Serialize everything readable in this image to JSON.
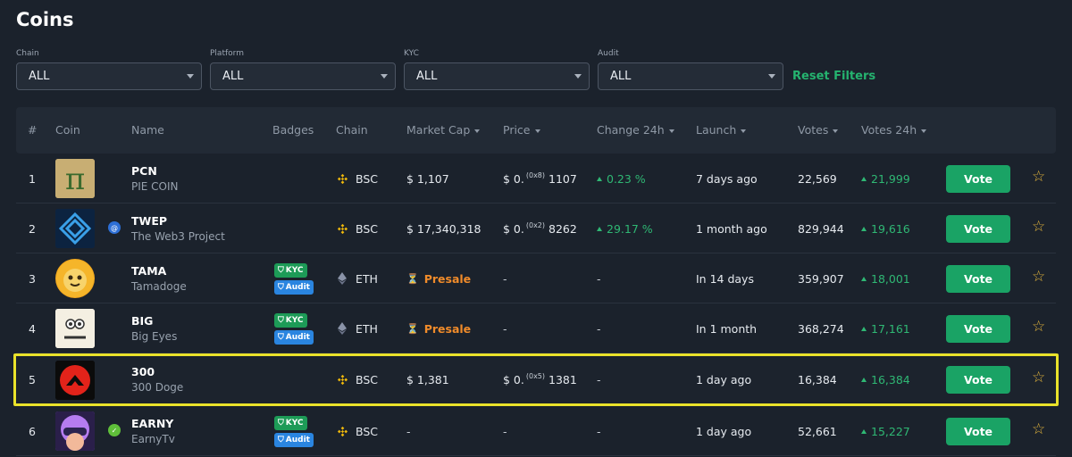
{
  "page": {
    "title": "Coins"
  },
  "filters": [
    {
      "label": "Chain",
      "value": "ALL"
    },
    {
      "label": "Platform",
      "value": "ALL"
    },
    {
      "label": "KYC",
      "value": "ALL"
    },
    {
      "label": "Audit",
      "value": "ALL"
    }
  ],
  "reset_label": "Reset Filters",
  "columns": {
    "rank": "#",
    "coin": "Coin",
    "name": "Name",
    "badges": "Badges",
    "chain": "Chain",
    "market_cap": "Market Cap",
    "price": "Price",
    "change": "Change 24h",
    "launch": "Launch",
    "votes": "Votes",
    "votes24": "Votes 24h"
  },
  "badge_labels": {
    "kyc": "KYC",
    "audit": "Audit"
  },
  "vote_label": "Vote",
  "colors": {
    "accent": "#1aa365",
    "highlight": "#eae22a",
    "presale": "#f08b2a"
  },
  "rows": [
    {
      "rank": "1",
      "symbol": "PCN",
      "name": "PIE COIN",
      "chain": "BSC",
      "market_cap": "$ 1,107",
      "price_prefix": "$ 0.",
      "price_zeros": "(0x8)",
      "price_digits": "1107",
      "change": "0.23 %",
      "launch": "7 days ago",
      "votes": "22,569",
      "votes24": "21,999"
    },
    {
      "rank": "2",
      "symbol": "TWEP",
      "name": "The Web3 Project",
      "chain": "BSC",
      "market_cap": "$ 17,340,318",
      "price_prefix": "$ 0.",
      "price_zeros": "(0x2)",
      "price_digits": "8262",
      "change": "29.17 %",
      "launch": "1 month ago",
      "votes": "829,944",
      "votes24": "19,616"
    },
    {
      "rank": "3",
      "symbol": "TAMA",
      "name": "Tamadoge",
      "chain": "ETH",
      "status": "Presale",
      "price": "-",
      "change": "-",
      "launch": "In 14 days",
      "votes": "359,907",
      "votes24": "18,001"
    },
    {
      "rank": "4",
      "symbol": "BIG",
      "name": "Big Eyes",
      "chain": "ETH",
      "status": "Presale",
      "price": "-",
      "change": "-",
      "launch": "In 1 month",
      "votes": "368,274",
      "votes24": "17,161"
    },
    {
      "rank": "5",
      "symbol": "300",
      "name": "300 Doge",
      "chain": "BSC",
      "market_cap": "$ 1,381",
      "price_prefix": "$ 0.",
      "price_zeros": "(0x5)",
      "price_digits": "1381",
      "change": "-",
      "launch": "1 day ago",
      "votes": "16,384",
      "votes24": "16,384"
    },
    {
      "rank": "6",
      "symbol": "EARNY",
      "name": "EarnyTv",
      "chain": "BSC",
      "market_cap": "-",
      "price": "-",
      "change": "-",
      "launch": "1 day ago",
      "votes": "52,661",
      "votes24": "15,227"
    }
  ]
}
